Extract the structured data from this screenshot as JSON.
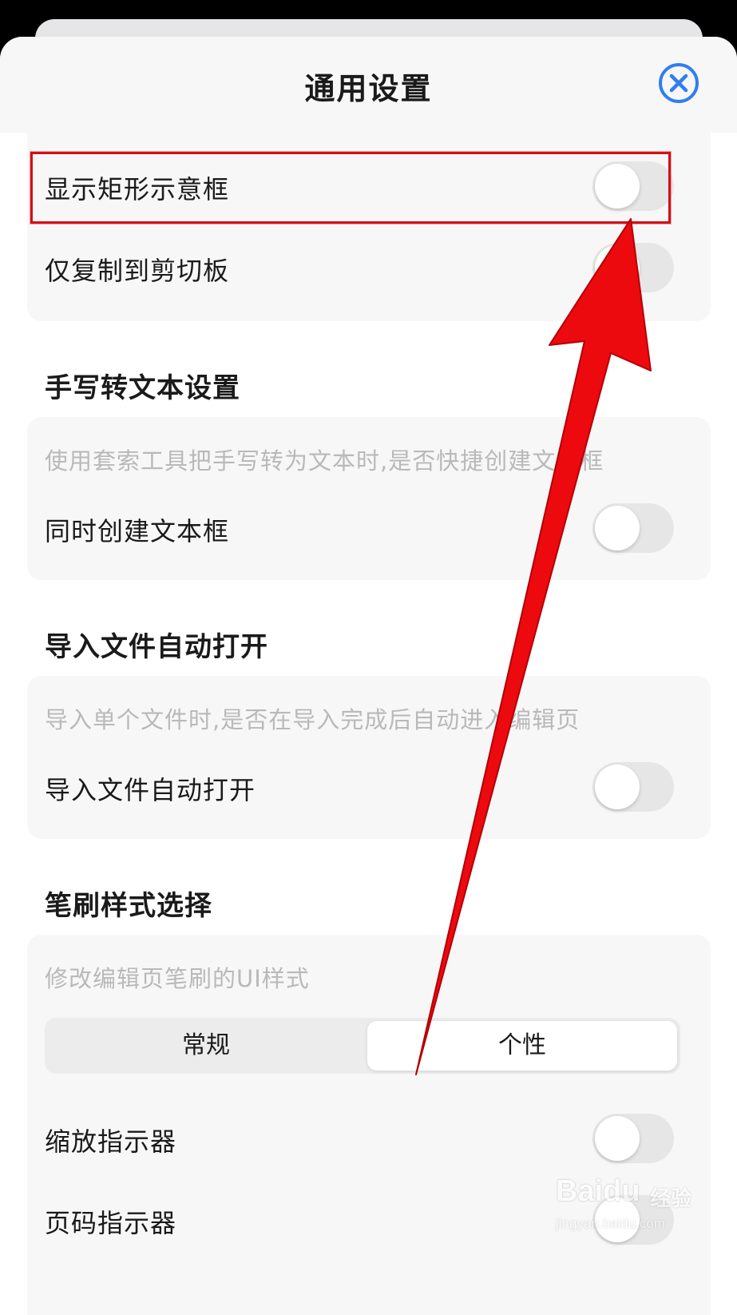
{
  "header": {
    "title": "通用设置",
    "close_icon": "close-circle-icon",
    "accent": "#2f7ef1"
  },
  "rows": {
    "show_rect": {
      "label": "显示矩形示意框",
      "on": false
    },
    "copy_clipboard": {
      "label": "仅复制到剪切板",
      "on": false
    }
  },
  "handwriting": {
    "title": "手写转文本设置",
    "description": "使用套索工具把手写转为文本时,是否快捷创建文本框",
    "row_label": "同时创建文本框",
    "on": false
  },
  "import": {
    "title": "导入文件自动打开",
    "description": "导入单个文件时,是否在导入完成后自动进入编辑页",
    "row_label": "导入文件自动打开",
    "on": false
  },
  "brush": {
    "title": "笔刷样式选择",
    "description": "修改编辑页笔刷的UI样式",
    "segments": [
      "常规",
      "个性"
    ],
    "selected": "个性",
    "zoom_indicator": {
      "label": "缩放指示器",
      "on": false
    },
    "page_indicator": {
      "label": "页码指示器",
      "on": false
    }
  },
  "annotation": {
    "highlight_color": "#d40f16",
    "arrow_color": "#ec0a0f"
  },
  "watermark": {
    "logo": "Baidu",
    "cn": "经验",
    "url": "jingyan.baidu.com"
  }
}
